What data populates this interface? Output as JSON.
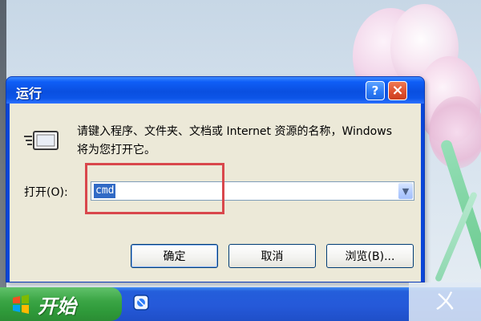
{
  "dialog": {
    "title": "运行",
    "help_button": "?",
    "close_button": "×",
    "description": "请键入程序、文件夹、文档或 Internet 资源的名称，Windows 将为您打开它。",
    "open_label": "打开(O):",
    "input_value": "cmd",
    "buttons": {
      "ok": "确定",
      "cancel": "取消",
      "browse": "浏览(B)..."
    }
  },
  "taskbar": {
    "start_label": "开始"
  },
  "watermark": "ㄨ"
}
